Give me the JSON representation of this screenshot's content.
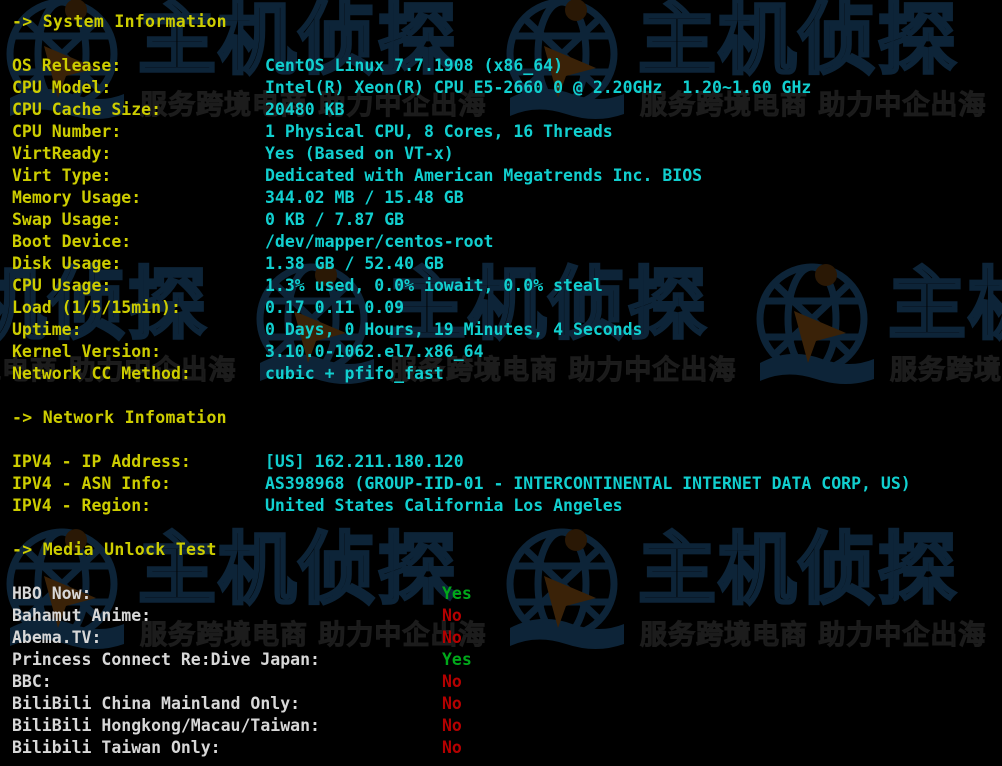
{
  "terminal": {
    "background_color": "#000000",
    "label_color": "#cdcd00",
    "value_color": "#11cfcf",
    "media_label_color": "#d8d8d8",
    "yes_color": "#00a81a",
    "no_color": "#b40000"
  },
  "watermark": {
    "logo_text": "主机侦探",
    "tagline": "服务跨境电商 助力中企出海",
    "color": "#0d2438",
    "icon": "globe-icon"
  },
  "sections": {
    "system": {
      "heading": "-> System Information",
      "rows": [
        {
          "label": "OS Release:",
          "value": "CentOS Linux 7.7.1908 (x86_64)"
        },
        {
          "label": "CPU Model:",
          "value": "Intel(R) Xeon(R) CPU E5-2660 0 @ 2.20GHz  1.20~1.60 GHz"
        },
        {
          "label": "CPU Cache Size:",
          "value": "20480 KB"
        },
        {
          "label": "CPU Number:",
          "value": "1 Physical CPU, 8 Cores, 16 Threads"
        },
        {
          "label": "VirtReady:",
          "value": "Yes (Based on VT-x)"
        },
        {
          "label": "Virt Type:",
          "value": "Dedicated with American Megatrends Inc. BIOS"
        },
        {
          "label": "Memory Usage:",
          "value": "344.02 MB / 15.48 GB"
        },
        {
          "label": "Swap Usage:",
          "value": "0 KB / 7.87 GB"
        },
        {
          "label": "Boot Device:",
          "value": "/dev/mapper/centos-root"
        },
        {
          "label": "Disk Usage:",
          "value": "1.38 GB / 52.40 GB"
        },
        {
          "label": "CPU Usage:",
          "value": "1.3% used, 0.0% iowait, 0.0% steal"
        },
        {
          "label": "Load (1/5/15min):",
          "value": "0.17 0.11 0.09"
        },
        {
          "label": "Uptime:",
          "value": "0 Days, 0 Hours, 19 Minutes, 4 Seconds"
        },
        {
          "label": "Kernel Version:",
          "value": "3.10.0-1062.el7.x86_64"
        },
        {
          "label": "Network CC Method:",
          "value": "cubic + pfifo_fast"
        }
      ]
    },
    "network": {
      "heading": "-> Network Infomation",
      "rows": [
        {
          "label": "IPV4 - IP Address:",
          "value": "[US] 162.211.180.120"
        },
        {
          "label": "IPV4 - ASN Info:",
          "value": "AS398968 (GROUP-IID-01 - INTERCONTINENTAL INTERNET DATA CORP, US)"
        },
        {
          "label": "IPV4 - Region:",
          "value": "United States California Los Angeles"
        }
      ]
    },
    "media": {
      "heading": "-> Media Unlock Test",
      "rows": [
        {
          "label": "HBO Now:",
          "value": "Yes",
          "state": "yes"
        },
        {
          "label": "Bahamut Anime:",
          "value": "No",
          "state": "no"
        },
        {
          "label": "Abema.TV:",
          "value": "No",
          "state": "no"
        },
        {
          "label": "Princess Connect Re:Dive Japan:",
          "value": "Yes",
          "state": "yes"
        },
        {
          "label": "BBC:",
          "value": "No",
          "state": "no"
        },
        {
          "label": "BiliBili China Mainland Only:",
          "value": "No",
          "state": "no"
        },
        {
          "label": "BiliBili Hongkong/Macau/Taiwan:",
          "value": "No",
          "state": "no"
        },
        {
          "label": "Bilibili Taiwan Only:",
          "value": "No",
          "state": "no"
        }
      ]
    }
  }
}
